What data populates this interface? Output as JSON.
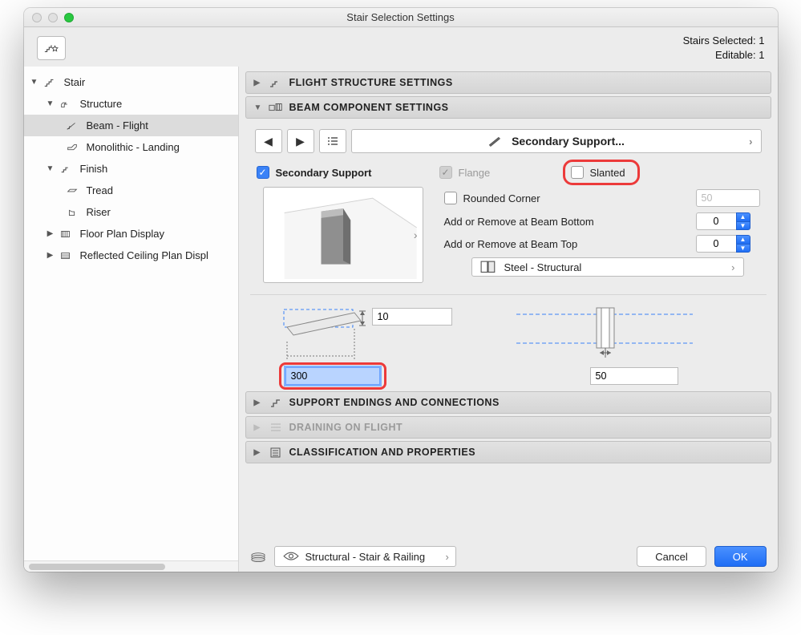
{
  "title": "Stair Selection Settings",
  "status": {
    "selected_label": "Stairs Selected:",
    "selected_value": "1",
    "editable_label": "Editable:",
    "editable_value": "1"
  },
  "tree": {
    "stair": "Stair",
    "structure": "Structure",
    "beam_flight": "Beam - Flight",
    "monolithic_landing": "Monolithic - Landing",
    "finish": "Finish",
    "tread": "Tread",
    "riser": "Riser",
    "floor_plan_display": "Floor Plan Display",
    "reflected_ceiling": "Reflected Ceiling Plan Displ"
  },
  "sections": {
    "flight": "FLIGHT STRUCTURE SETTINGS",
    "beam": "BEAM COMPONENT SETTINGS",
    "endings": "SUPPORT ENDINGS AND CONNECTIONS",
    "draining": "DRAINING ON FLIGHT",
    "classification": "CLASSIFICATION AND PROPERTIES"
  },
  "pager": {
    "name": "Secondary Support..."
  },
  "options": {
    "secondary_support": "Secondary Support",
    "flange": "Flange",
    "slanted": "Slanted",
    "rounded_corner": "Rounded Corner",
    "rounded_corner_value": "50",
    "add_remove_bottom": "Add or Remove at Beam Bottom",
    "add_remove_bottom_value": "0",
    "add_remove_top": "Add or Remove at Beam Top",
    "add_remove_top_value": "0",
    "material": "Steel - Structural"
  },
  "dimensions": {
    "width": "10",
    "length": "300",
    "right_value": "50"
  },
  "bottom": {
    "layer": "Structural - Stair & Railing",
    "cancel": "Cancel",
    "ok": "OK"
  }
}
